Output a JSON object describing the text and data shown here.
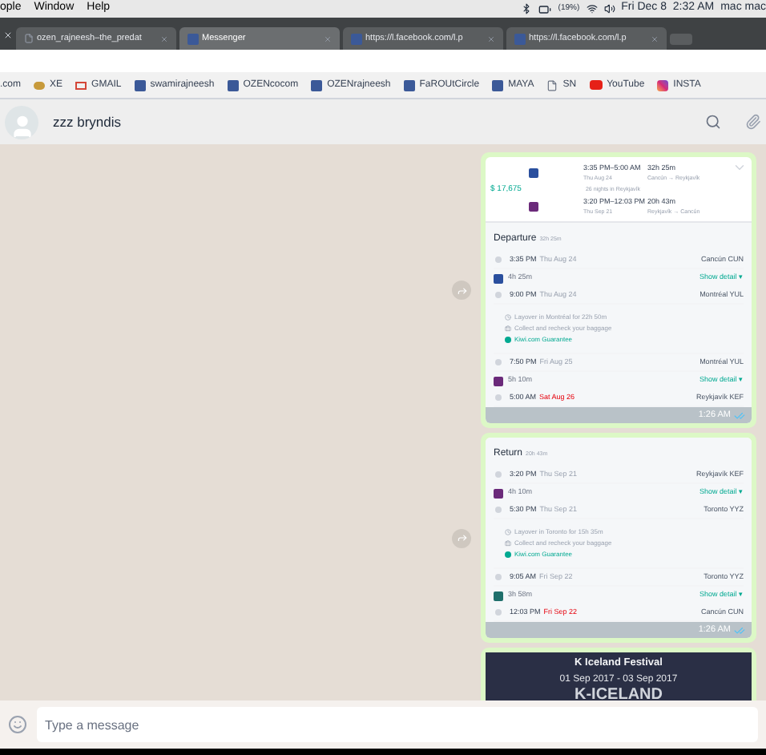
{
  "menu_bar": {
    "items": [
      "ople",
      "Window",
      "Help"
    ],
    "battery": "(19%)",
    "clock": "Fri Dec 8  2:32 AM",
    "user": "mac mac"
  },
  "tabs": [
    {
      "title": "ozen_rajneesh–the_predat",
      "kind": "page",
      "selected": false
    },
    {
      "title": "Messenger",
      "kind": "facebook",
      "selected": true
    },
    {
      "title": "https://l.facebook.com/l.p",
      "kind": "facebook",
      "selected": false
    },
    {
      "title": "https://l.facebook.com/l.p",
      "kind": "facebook",
      "selected": false
    }
  ],
  "bookmarks": [
    {
      "label": ".com",
      "kind": "plain"
    },
    {
      "label": "XE",
      "kind": "xe"
    },
    {
      "label": "GMAIL",
      "kind": "gmail"
    },
    {
      "label": "swamirajneesh",
      "kind": "facebook"
    },
    {
      "label": "OZENcocom",
      "kind": "facebook"
    },
    {
      "label": "OZENrajneesh",
      "kind": "facebook"
    },
    {
      "label": "FaROUtCircle",
      "kind": "facebook"
    },
    {
      "label": "MAYA",
      "kind": "facebook"
    },
    {
      "label": "SN",
      "kind": "page"
    },
    {
      "label": "YouTube",
      "kind": "youtube"
    },
    {
      "label": "INSTA",
      "kind": "instagram"
    }
  ],
  "chat": {
    "name": "zzz bryndis"
  },
  "messages": [
    {
      "kind": "itinerary",
      "time": "1:26 AM",
      "summary": {
        "price": "$ 17,675",
        "stay": "26 nights in Reykjavík",
        "flights": [
          {
            "times": "3:35 PM–5:00 AM",
            "date": "Thu Aug 24",
            "duration": "32h 25m",
            "route": "Cancún → Reykjavík"
          },
          {
            "times": "3:20 PM–12:03 PM",
            "date": "Thu Sep 21",
            "duration": "20h 43m",
            "route": "Reykjavík → Cancún"
          }
        ]
      },
      "section": {
        "title": "Departure",
        "duration": "32h 25m",
        "steps": [
          {
            "kind": "stop",
            "time": "3:35 PM",
            "date": "Thu Aug 24",
            "place": "Cancún CUN",
            "late": false
          },
          {
            "kind": "leg",
            "duration": "4h 25m",
            "link": "Show detail ▾",
            "color": "#2a4f9e"
          },
          {
            "kind": "stop",
            "time": "9:00 PM",
            "date": "Thu Aug 24",
            "place": "Montréal YUL",
            "late": false
          },
          {
            "kind": "layover",
            "lines": [
              "Layover in Montréal for 22h 50m",
              "Collect and recheck your baggage",
              "Kiwi.com Guarantee"
            ]
          },
          {
            "kind": "stop",
            "time": "7:50 PM",
            "date": "Fri Aug 25",
            "place": "Montréal YUL",
            "late": false
          },
          {
            "kind": "leg",
            "duration": "5h 10m",
            "link": "Show detail ▾",
            "color": "#6b2a7a"
          },
          {
            "kind": "stop",
            "time": "5:00 AM",
            "date": "Sat Aug 26",
            "place": "Reykjavík KEF",
            "late": true
          }
        ]
      }
    },
    {
      "kind": "itinerary",
      "time": "1:26 AM",
      "section": {
        "title": "Return",
        "duration": "20h 43m",
        "steps": [
          {
            "kind": "stop",
            "time": "3:20 PM",
            "date": "Thu Sep 21",
            "place": "Reykjavík KEF",
            "late": false
          },
          {
            "kind": "leg",
            "duration": "4h 10m",
            "link": "Show detail ▾",
            "color": "#6b2a7a"
          },
          {
            "kind": "stop",
            "time": "5:30 PM",
            "date": "Thu Sep 21",
            "place": "Toronto YYZ",
            "late": false
          },
          {
            "kind": "layover",
            "lines": [
              "Layover in Toronto for 15h 35m",
              "Collect and recheck your baggage",
              "Kiwi.com Guarantee"
            ]
          },
          {
            "kind": "stop",
            "time": "9:05 AM",
            "date": "Fri Sep 22",
            "place": "Toronto YYZ",
            "late": false
          },
          {
            "kind": "leg",
            "duration": "3h 58m",
            "link": "Show detail ▾",
            "color": "#1f6f6b"
          },
          {
            "kind": "stop",
            "time": "12:03 PM",
            "date": "Fri Sep 22",
            "place": "Cancún CUN",
            "late": true
          }
        ]
      }
    },
    {
      "kind": "image",
      "title": "K Iceland Festival",
      "dates": "01 Sep 2017 -  03 Sep 2017",
      "logo": "K-ICELAND"
    }
  ],
  "composer": {
    "placeholder": "Type a message"
  }
}
